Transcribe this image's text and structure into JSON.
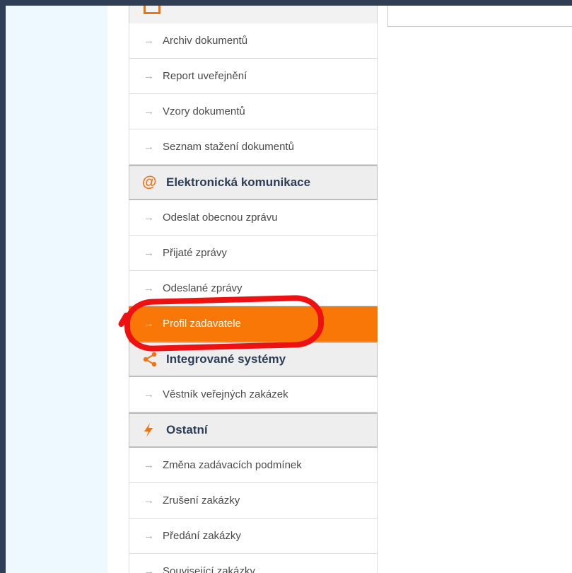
{
  "colors": {
    "accent": "#f97707",
    "highlight": "#ee1111",
    "section_text": "#2c3e55",
    "page_background": "#2f3e55"
  },
  "sidebar": {
    "items_top": [
      {
        "label": "Archiv dokumentů"
      },
      {
        "label": "Report uveřejnění"
      },
      {
        "label": "Vzory dokumentů"
      },
      {
        "label": "Seznam stažení dokumentů"
      }
    ],
    "sections": [
      {
        "title": "Elektronická komunikace",
        "icon": "at-sign-icon",
        "items": [
          {
            "label": "Odeslat obecnou zprávu"
          },
          {
            "label": "Přijaté zprávy"
          },
          {
            "label": "Odeslané zprávy"
          },
          {
            "label": "Profil zadavatele",
            "active": true
          }
        ]
      },
      {
        "title": "Integrované systémy",
        "icon": "share-icon",
        "items": [
          {
            "label": "Věstník veřejných zakázek"
          }
        ]
      },
      {
        "title": "Ostatní",
        "icon": "lightning-icon",
        "items": [
          {
            "label": "Změna zadávacích podmínek"
          },
          {
            "label": "Zrušení zakázky"
          },
          {
            "label": "Předání zakázky"
          },
          {
            "label": "Související zakázky"
          }
        ]
      }
    ]
  }
}
